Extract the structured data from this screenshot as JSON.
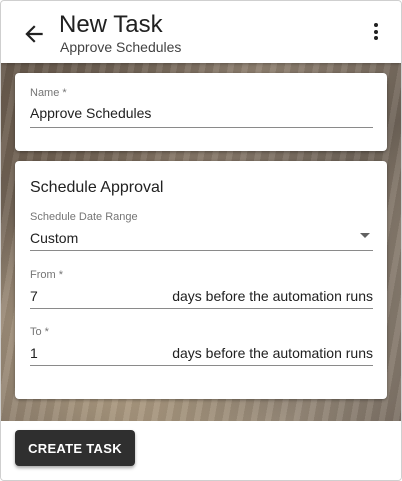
{
  "header": {
    "title": "New Task",
    "subtitle": "Approve Schedules",
    "back_icon": "arrow-left-icon",
    "menu_icon": "more-vertical-icon"
  },
  "name_card": {
    "label": "Name *",
    "value": "Approve Schedules"
  },
  "schedule_card": {
    "title": "Schedule Approval",
    "range": {
      "label": "Schedule Date Range",
      "value": "Custom"
    },
    "from": {
      "label": "From *",
      "value": "7",
      "suffix": "days before the automation runs"
    },
    "to": {
      "label": "To *",
      "value": "1",
      "suffix": "days before the automation runs"
    }
  },
  "footer": {
    "create_label": "CREATE TASK"
  },
  "colors": {
    "button_bg": "#2f2f2f",
    "header_bg": "#ffffff"
  }
}
